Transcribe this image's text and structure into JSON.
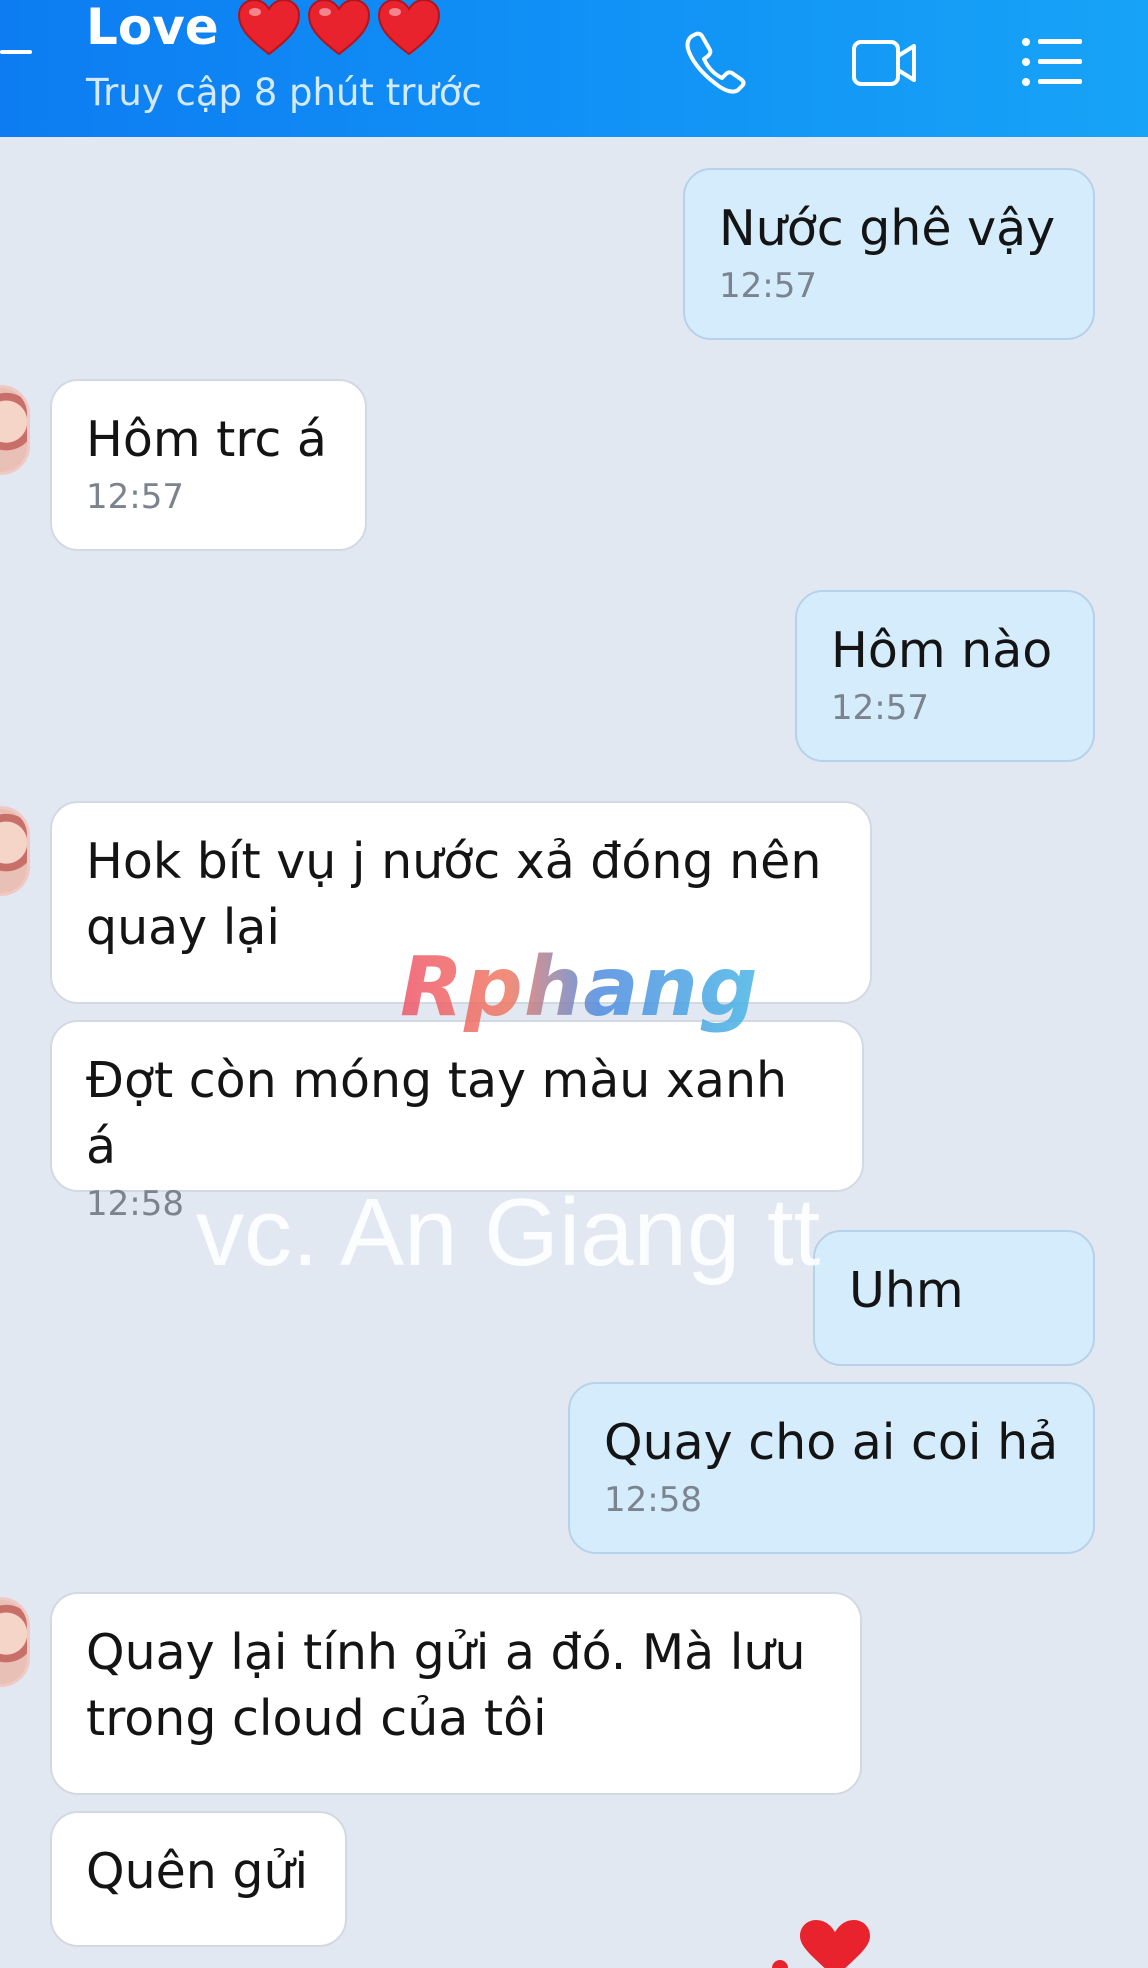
{
  "header": {
    "title": "Love",
    "status": "Truy cập 8 phút trước"
  },
  "icons": {
    "back": "back-icon",
    "call": "phone-icon",
    "video": "video-camera-icon",
    "menu": "list-menu-icon",
    "hearts": "red-heart-emoji"
  },
  "colors": {
    "header_start": "#0d7cf2",
    "header_end": "#17a3f7",
    "incoming_bubble": "#ffffff",
    "outgoing_bubble": "#d5ecfc",
    "background": "#e2e8f1",
    "heart": "#e8232e"
  },
  "messages": [
    {
      "side": "out",
      "text": "Nước ghê vậy",
      "time": "12:57"
    },
    {
      "side": "in",
      "text": "Hôm trc á",
      "time": "12:57"
    },
    {
      "side": "out",
      "text": "Hôm nào",
      "time": "12:57"
    },
    {
      "side": "in",
      "text": "Hok bít vụ j nước xả đóng nên\nquay lại",
      "time": ""
    },
    {
      "side": "in",
      "text": "Đợt còn móng tay màu xanh á",
      "time": "12:58"
    },
    {
      "side": "out",
      "text": "Uhm",
      "time": ""
    },
    {
      "side": "out",
      "text": "Quay cho ai coi hả",
      "time": "12:58"
    },
    {
      "side": "in",
      "text": "Quay lại tính gửi a đó. Mà lưu\ntrong cloud của tôi",
      "time": ""
    },
    {
      "side": "in",
      "text": "Quên gửi",
      "time": ""
    }
  ],
  "watermarks": {
    "logo": "Rphang",
    "caption": "vc. An Giang tt"
  }
}
